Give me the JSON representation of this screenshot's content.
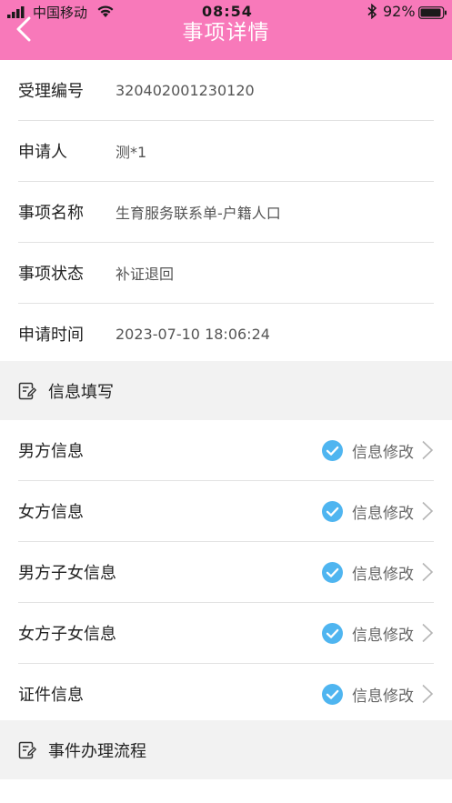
{
  "status_bar": {
    "carrier": "中国移动",
    "time": "08:54",
    "battery_percent": "92%"
  },
  "header": {
    "title": "事项详情"
  },
  "info": [
    {
      "label": "受理编号",
      "value": "320402001230120"
    },
    {
      "label": "申请人",
      "value": "测*1"
    },
    {
      "label": "事项名称",
      "value": "生育服务联系单-户籍人口"
    },
    {
      "label": "事项状态",
      "value": "补证退回"
    },
    {
      "label": "申请时间",
      "value": "2023-07-10 18:06:24"
    }
  ],
  "sections": {
    "fill_title": "信息填写",
    "process_title": "事件办理流程"
  },
  "fill_items": [
    {
      "label": "男方信息",
      "status": "信息修改"
    },
    {
      "label": "女方信息",
      "status": "信息修改"
    },
    {
      "label": "男方子女信息",
      "status": "信息修改"
    },
    {
      "label": "女方子女信息",
      "status": "信息修改"
    },
    {
      "label": "证件信息",
      "status": "信息修改"
    }
  ],
  "colors": {
    "header_bg": "#f879ba",
    "check_blue": "#4fb5f0",
    "section_bg": "#f2f2f2"
  }
}
